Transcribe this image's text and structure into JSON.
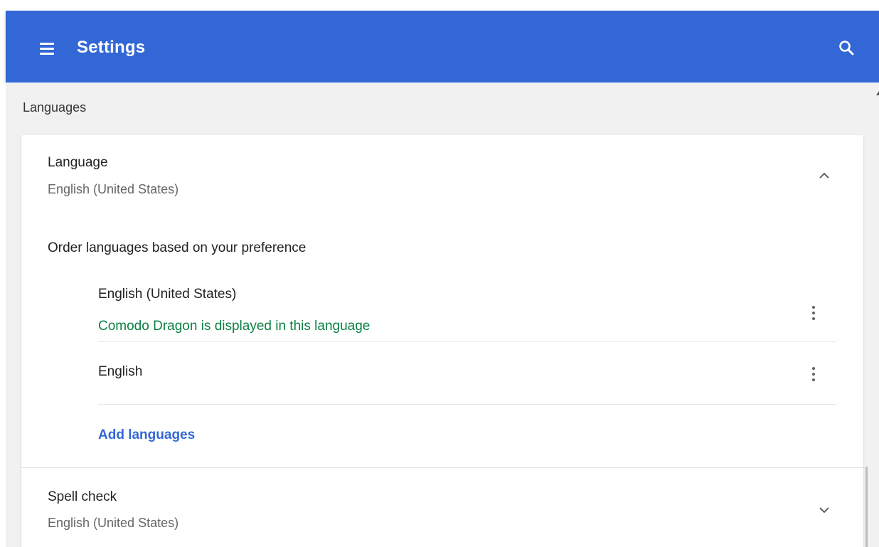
{
  "header": {
    "title": "Settings",
    "menu_icon": "hamburger-menu-icon",
    "search_icon": "search-icon",
    "background_color": "#3367d6"
  },
  "section": {
    "title": "Languages"
  },
  "language_setting": {
    "title": "Language",
    "value": "English (United States)",
    "expanded": true,
    "order_label": "Order languages based on your preference",
    "languages": [
      {
        "name": "English (United States)",
        "note": "Comodo Dragon is displayed in this language"
      },
      {
        "name": "English",
        "note": ""
      }
    ],
    "add_label": "Add languages"
  },
  "spell_check": {
    "title": "Spell check",
    "value": "English (United States)",
    "expanded": false
  },
  "colors": {
    "accent": "#3367d6",
    "note_green": "#0b8043",
    "page_background": "#f1f1f1"
  }
}
